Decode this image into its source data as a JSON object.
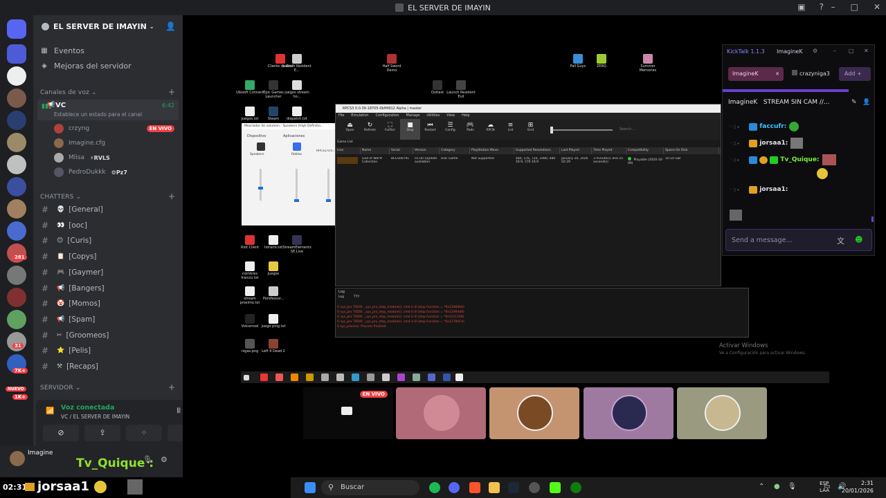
{
  "window": {
    "title": "EL SERVER DE IMAYIN"
  },
  "server": {
    "name": "EL SERVER DE IMAYIN",
    "badges": [
      "281",
      "31",
      "7K+",
      "NUEVO",
      "1K+"
    ]
  },
  "nav": {
    "events": "Eventos",
    "boosts": "Mejoras del servidor"
  },
  "voice_category": "Canales de voz",
  "voice_channel": {
    "name": "VC",
    "status_placeholder": "Establece un estado para el canal",
    "elapsed": "6:42",
    "users": [
      {
        "name": "crzyng",
        "live": "EN VIVO"
      },
      {
        "name": "Imagine.cfg"
      },
      {
        "name": "Mlisa",
        "tag": "RVLS"
      },
      {
        "name": "PedroDukkk",
        "tag": "Pz7"
      }
    ]
  },
  "text_category": "CHATTERS",
  "channels": [
    {
      "name": "[General]",
      "emoji": "💀"
    },
    {
      "name": "[ooc]",
      "emoji": "👀"
    },
    {
      "name": "[Curis]",
      "emoji": "😊"
    },
    {
      "name": "[Copys]",
      "emoji": "📋"
    },
    {
      "name": "[Gaymer]",
      "emoji": "🎮"
    },
    {
      "name": "[Bangers]",
      "emoji": "📢"
    },
    {
      "name": "[Momos]",
      "emoji": "🤡"
    },
    {
      "name": "[Spam]",
      "emoji": "📢"
    },
    {
      "name": "[Groomeos]",
      "emoji": "✂"
    },
    {
      "name": "[Pelis]",
      "emoji": "⭐"
    },
    {
      "name": "[Recaps]",
      "emoji": "⚒"
    }
  ],
  "servers_category": "SERVIDOR",
  "voice_panel": {
    "connected": "Voz conectada",
    "location": "VC / EL SERVER DE IMAYIN"
  },
  "user_bar": {
    "username": "Imagine"
  },
  "desktop": {
    "icons_left": [
      "Cliente de Riot",
      "Launch Resident E...",
      "Ubisoft Connect",
      "Epic Games Launcher",
      "juegos stream ho...",
      "Juegos.txt",
      "Steam",
      "dispatch.txt",
      "Riot Client",
      "horario.txt",
      "StreamElements SE.Live",
      "nombres francis.txt",
      "Juegos",
      "stream proximo.txt",
      "Porofessor...",
      "Voicemod",
      "juego ping.txt",
      "nigas.png",
      "Left 4 Dead 2"
    ],
    "icons_top": [
      "Half Sword Demo",
      "Outlast",
      "Launch Resident Evil",
      "Fall Guys",
      "ZERO",
      "Summer Memories"
    ],
    "activate_title": "Activar Windows",
    "activate_sub": "Ve a Configuración para activar Windows."
  },
  "rpcs3": {
    "title": "RPCS3 0.0.39-18705-0bff4912 Alpha | master",
    "menu": [
      "File",
      "Emulation",
      "Configuration",
      "Manage",
      "Utilities",
      "View",
      "Help"
    ],
    "tools": [
      "Open",
      "Refresh",
      "FullScr",
      "Stop",
      "Restart",
      "Config",
      "Pads",
      "RPCN",
      "List",
      "Grid"
    ],
    "search_placeholder": "Search...",
    "game_list_label": "Game List",
    "columns": [
      "Icon",
      "Name",
      "Serial",
      "Version",
      "Category",
      "PlayStation Move",
      "Supported Resolutions",
      "Last Played",
      "Time Played",
      "Compatibility",
      "Space On Disk"
    ],
    "row": {
      "name": "God of War® Collection",
      "serial": "BCES00791",
      "version": "01.00 (Update available)",
      "category": "Disc Game",
      "move": "Not Supported",
      "resolutions": "480, 576, 720, 1080, 480 16:9, 576 16:9",
      "last_played": "January 20, 2026 02:29",
      "time_played": "3 minute(s) and 25 second(s)",
      "compat": "Playable (2020-10-09)",
      "size": "10.10 GiB"
    }
  },
  "log": {
    "title": "Log",
    "tabs": [
      "Log",
      "TTY"
    ],
    "lines": [
      "U sys_prx TODO: _sys_prx_stop_module(): cmd is 8 (stop function = *0x12460b0)",
      "U sys_prx TODO: _sys_prx_stop_module(): cmd is 8 (stop function = *0x12464d8)",
      "U sys_prx TODO: _sys_prx_stop_module(): cmd is 8 (stop function = *0x12c1148)",
      "U sys_prx TODO: _sys_prx_stop_module(): cmd is 8 (stop function = *0x1178414)",
      "S sys_process: Process finished"
    ]
  },
  "volume_mixer": {
    "title": "Mezclador de volumen - Speakers (High Definitio...",
    "device": "Dispositivo",
    "apps": "Aplicaciones",
    "speakers": "Speakers",
    "roblox": "Roblox",
    "rpcs3": "RPCS3 0.0.39-18705..."
  },
  "kicktalk": {
    "app": "KickTalk 1.1.3",
    "user": "ImagineK",
    "tabs": [
      "ImagineK",
      "crazyniga3"
    ],
    "add": "Add",
    "stream_title": "STREAM SIN CAM //...",
    "stream_user": "ImagineK",
    "messages": [
      {
        "user": "faccufr:"
      },
      {
        "user": "jorsaa1:"
      },
      {
        "user": "Tv_Quique:"
      },
      {
        "user": "jorsaa1:"
      }
    ],
    "placeholder": "Send a message..."
  },
  "tiles": {
    "live": "EN VIVO"
  },
  "ticker": {
    "time": "02:31",
    "name": "jorsaa1 :",
    "name2": "Tv_Quique :"
  },
  "taskbar": {
    "search": "Buscar",
    "lang1": "ESP",
    "lang2": "LAA",
    "time": "2:31",
    "date": "20/01/2026"
  },
  "colors": {
    "discord_bg": "#2b2d31",
    "live": "#f23f43",
    "voice_green": "#23a55a",
    "kick_accent": "#6b3fd1"
  }
}
